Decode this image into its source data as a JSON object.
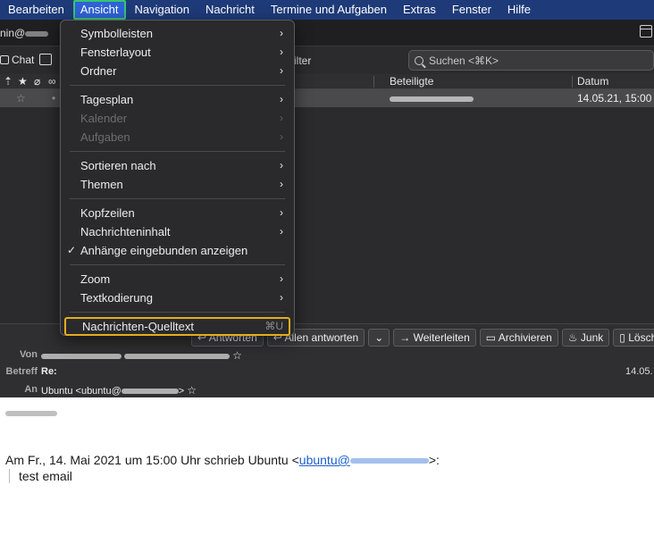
{
  "menubar": {
    "items": [
      "Bearbeiten",
      "Ansicht",
      "Navigation",
      "Nachricht",
      "Termine und Aufgaben",
      "Extras",
      "Fenster",
      "Hilfe"
    ]
  },
  "account": {
    "prefix": "nin@"
  },
  "toolbar": {
    "chat_label": "Chat",
    "filter_label": "ilter",
    "search_placeholder": "Suchen <⌘K>"
  },
  "columns": {
    "participants": "Beteiligte",
    "date": "Datum"
  },
  "message_row": {
    "date": "14.05.21, 15:00"
  },
  "actions": {
    "reply": "Antworten",
    "reply_all": "Allen antworten",
    "forward": "Weiterleiten",
    "archive": "Archivieren",
    "junk": "Junk",
    "delete": "Löschen"
  },
  "header": {
    "from_label": "Von",
    "subject_label": "Betreff",
    "subject_value": "Re:",
    "to_label": "An",
    "to_value": "Ubuntu <ubuntu@",
    "to_suffix": ">",
    "date_short": "14.05."
  },
  "body": {
    "quote_intro": "Am Fr., 14. Mai 2021 um 15:00 Uhr schrieb Ubuntu <",
    "quote_link": "ubuntu@",
    "quote_close": ">:",
    "quote_text": "test email"
  },
  "view_menu": {
    "items": [
      {
        "label": "Symbolleisten",
        "submenu": true,
        "disabled": false
      },
      {
        "label": "Fensterlayout",
        "submenu": true,
        "disabled": false
      },
      {
        "label": "Ordner",
        "submenu": true,
        "disabled": false
      },
      {
        "sep": true
      },
      {
        "label": "Tagesplan",
        "submenu": true,
        "disabled": false
      },
      {
        "label": "Kalender",
        "submenu": true,
        "disabled": true
      },
      {
        "label": "Aufgaben",
        "submenu": true,
        "disabled": true
      },
      {
        "sep": true
      },
      {
        "label": "Sortieren nach",
        "submenu": true,
        "disabled": false
      },
      {
        "label": "Themen",
        "submenu": true,
        "disabled": false
      },
      {
        "sep": true
      },
      {
        "label": "Kopfzeilen",
        "submenu": true,
        "disabled": false
      },
      {
        "label": "Nachrichteninhalt",
        "submenu": true,
        "disabled": false
      },
      {
        "label": "Anhänge eingebunden anzeigen",
        "checked": true,
        "disabled": false
      },
      {
        "sep": true
      },
      {
        "label": "Zoom",
        "submenu": true,
        "disabled": false
      },
      {
        "label": "Textkodierung",
        "submenu": true,
        "disabled": false
      },
      {
        "sep": true
      },
      {
        "label": "Nachrichten-Quelltext",
        "shortcut": "⌘U",
        "highlight": true,
        "disabled": false
      }
    ]
  },
  "colors": {
    "menubar": "#1e3a78",
    "active_menu": "#2f62d6",
    "active_outline": "#38c472",
    "highlight_outline": "#e2ae1e",
    "link": "#1a5fd0"
  }
}
